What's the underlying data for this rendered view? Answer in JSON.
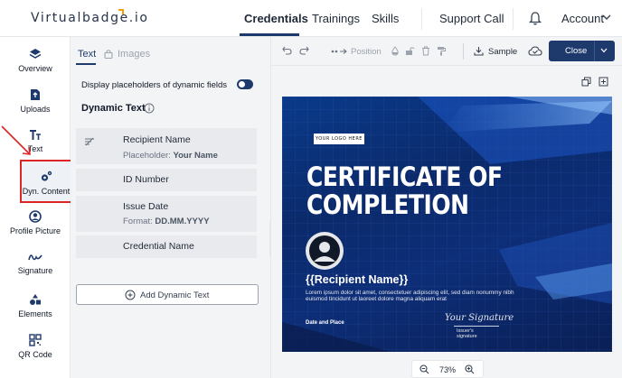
{
  "brand": {
    "name": "Virtualbadge.io",
    "accent": "#f59e0b",
    "primary": "#1e3a6d"
  },
  "nav": {
    "items": [
      "Credentials",
      "Trainings",
      "Skills"
    ],
    "support": "Support Call",
    "account": "Account"
  },
  "rail": {
    "items": [
      {
        "label": "Overview",
        "icon": "layers-icon"
      },
      {
        "label": "Uploads",
        "icon": "upload-icon"
      },
      {
        "label": "Text",
        "icon": "text-icon"
      },
      {
        "label": "Dyn. Content",
        "icon": "gears-icon"
      },
      {
        "label": "Profile Picture",
        "icon": "user-circle-icon"
      },
      {
        "label": "Signature",
        "icon": "signature-icon"
      },
      {
        "label": "Elements",
        "icon": "shapes-icon"
      },
      {
        "label": "QR Code",
        "icon": "qr-icon"
      }
    ],
    "highlight_color": "#dc2626"
  },
  "panel": {
    "tabs": [
      "Text",
      "Images"
    ],
    "toggle_label": "Display placeholders of dynamic fields",
    "section_title": "Dynamic Text",
    "fields": [
      {
        "name": "Recipient Name",
        "placeholder_label": "Placeholder:",
        "placeholder_value": "Your Name"
      },
      {
        "name": "ID Number"
      },
      {
        "name": "Issue Date",
        "placeholder_label": "Format:",
        "placeholder_value": "DD.MM.YYYY"
      },
      {
        "name": "Credential Name"
      }
    ],
    "add_button": "Add Dynamic Text"
  },
  "toolbar": {
    "position_label": "Position",
    "sample_label": "Sample",
    "close_label": "Close"
  },
  "certificate": {
    "logo_text": "YOUR LOGO HERE",
    "title_line1": "CERTIFICATE OF",
    "title_line2": "COMPLETION",
    "recipient": "{{Recipient Name}}",
    "lorem": "Lorem ipsum dolor sit amet, consectetuer adipiscing elit, sed diam nonummy nibh euismod tincidunt ut laoreet dolore magna aliquam erat",
    "date_label": "Date and Place",
    "signature": "Your Signature",
    "issuer_label": "Issuer's signature"
  },
  "zoom": {
    "level": "73%"
  }
}
